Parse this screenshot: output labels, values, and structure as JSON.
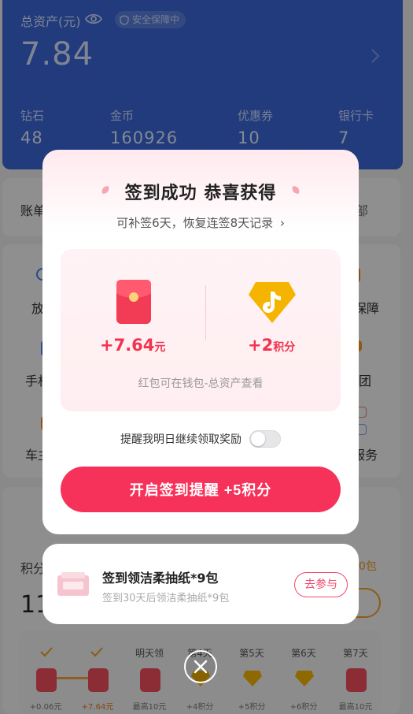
{
  "header": {
    "total_label": "总资产(元)",
    "safe_badge": "安全保障中",
    "total_value": "7.84",
    "stats": [
      {
        "label": "钻石",
        "value": "48"
      },
      {
        "label": "金币",
        "value": "160926"
      },
      {
        "label": "优惠券",
        "value": "10"
      },
      {
        "label": "银行卡",
        "value": "7"
      }
    ]
  },
  "background": {
    "account_text": "账单",
    "account_right": "部",
    "left_items": [
      "放",
      "手机",
      "车主"
    ],
    "right_items": [
      "保障",
      "团",
      "服务"
    ],
    "points_label": "积分",
    "points_value": "11",
    "points_right": "0包"
  },
  "checkin_strip": {
    "days": [
      "",
      "",
      "明天领",
      "第4天",
      "第5天",
      "第6天",
      "第7天"
    ],
    "rewards": [
      "+0.06元",
      "+7.64元",
      "最高10元",
      "+4积分",
      "+5积分",
      "+6积分",
      "最高10元"
    ]
  },
  "modal": {
    "title": "签到成功 恭喜获得",
    "subtitle": "可补签6天，恢复连签8天记录",
    "reward_cash_amount": "+7.64",
    "reward_cash_unit": "元",
    "reward_points_amount": "+2",
    "reward_points_unit": "积分",
    "note": "红包可在钱包-总资产查看",
    "remind_label": "提醒我明日继续领取奖励",
    "remind_on": false,
    "cta_label": "开启签到提醒 +5积分"
  },
  "promo": {
    "title": "签到领洁柔抽纸*9包",
    "subtitle": "签到30天后领洁柔抽纸*9包",
    "button": "去参与"
  },
  "colors": {
    "header_blue": "#3a66d6",
    "accent_red": "#f7325a",
    "reward_red": "#f2334f",
    "gold": "#f5b400"
  }
}
